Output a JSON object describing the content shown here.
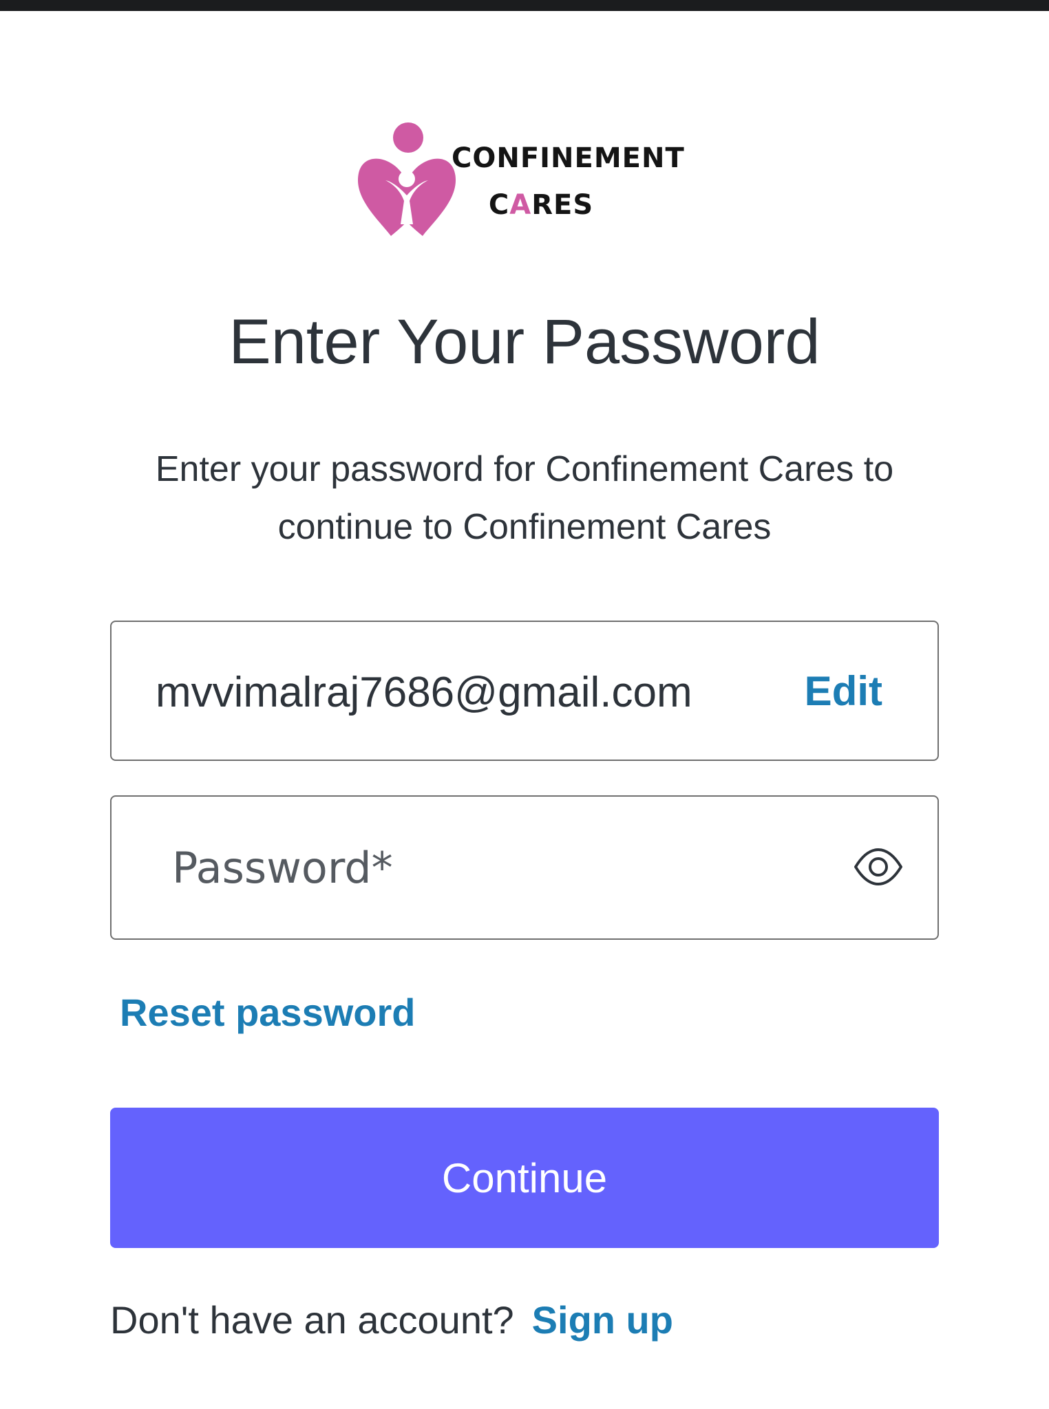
{
  "brand": {
    "line1": "CONFINEMENT",
    "line2_prefix": "C",
    "line2_accent": "A",
    "line2_suffix": "RES",
    "accent_color": "#cf5aa3",
    "logo_icon": "mother-heart-icon"
  },
  "title": "Enter Your Password",
  "subtitle": "Enter your password for Confinement Cares to continue to Confinement Cares",
  "email": {
    "value": "mvvimalraj7686@gmail.com",
    "edit_label": "Edit"
  },
  "password": {
    "placeholder": "Password*",
    "value": "",
    "toggle_icon": "eye-icon"
  },
  "reset_label": "Reset password",
  "continue_label": "Continue",
  "signup": {
    "prompt": "Don't have an account?",
    "link_label": "Sign up"
  },
  "colors": {
    "primary_button": "#6462fd",
    "link": "#1c7db4",
    "text": "#2d333a"
  }
}
